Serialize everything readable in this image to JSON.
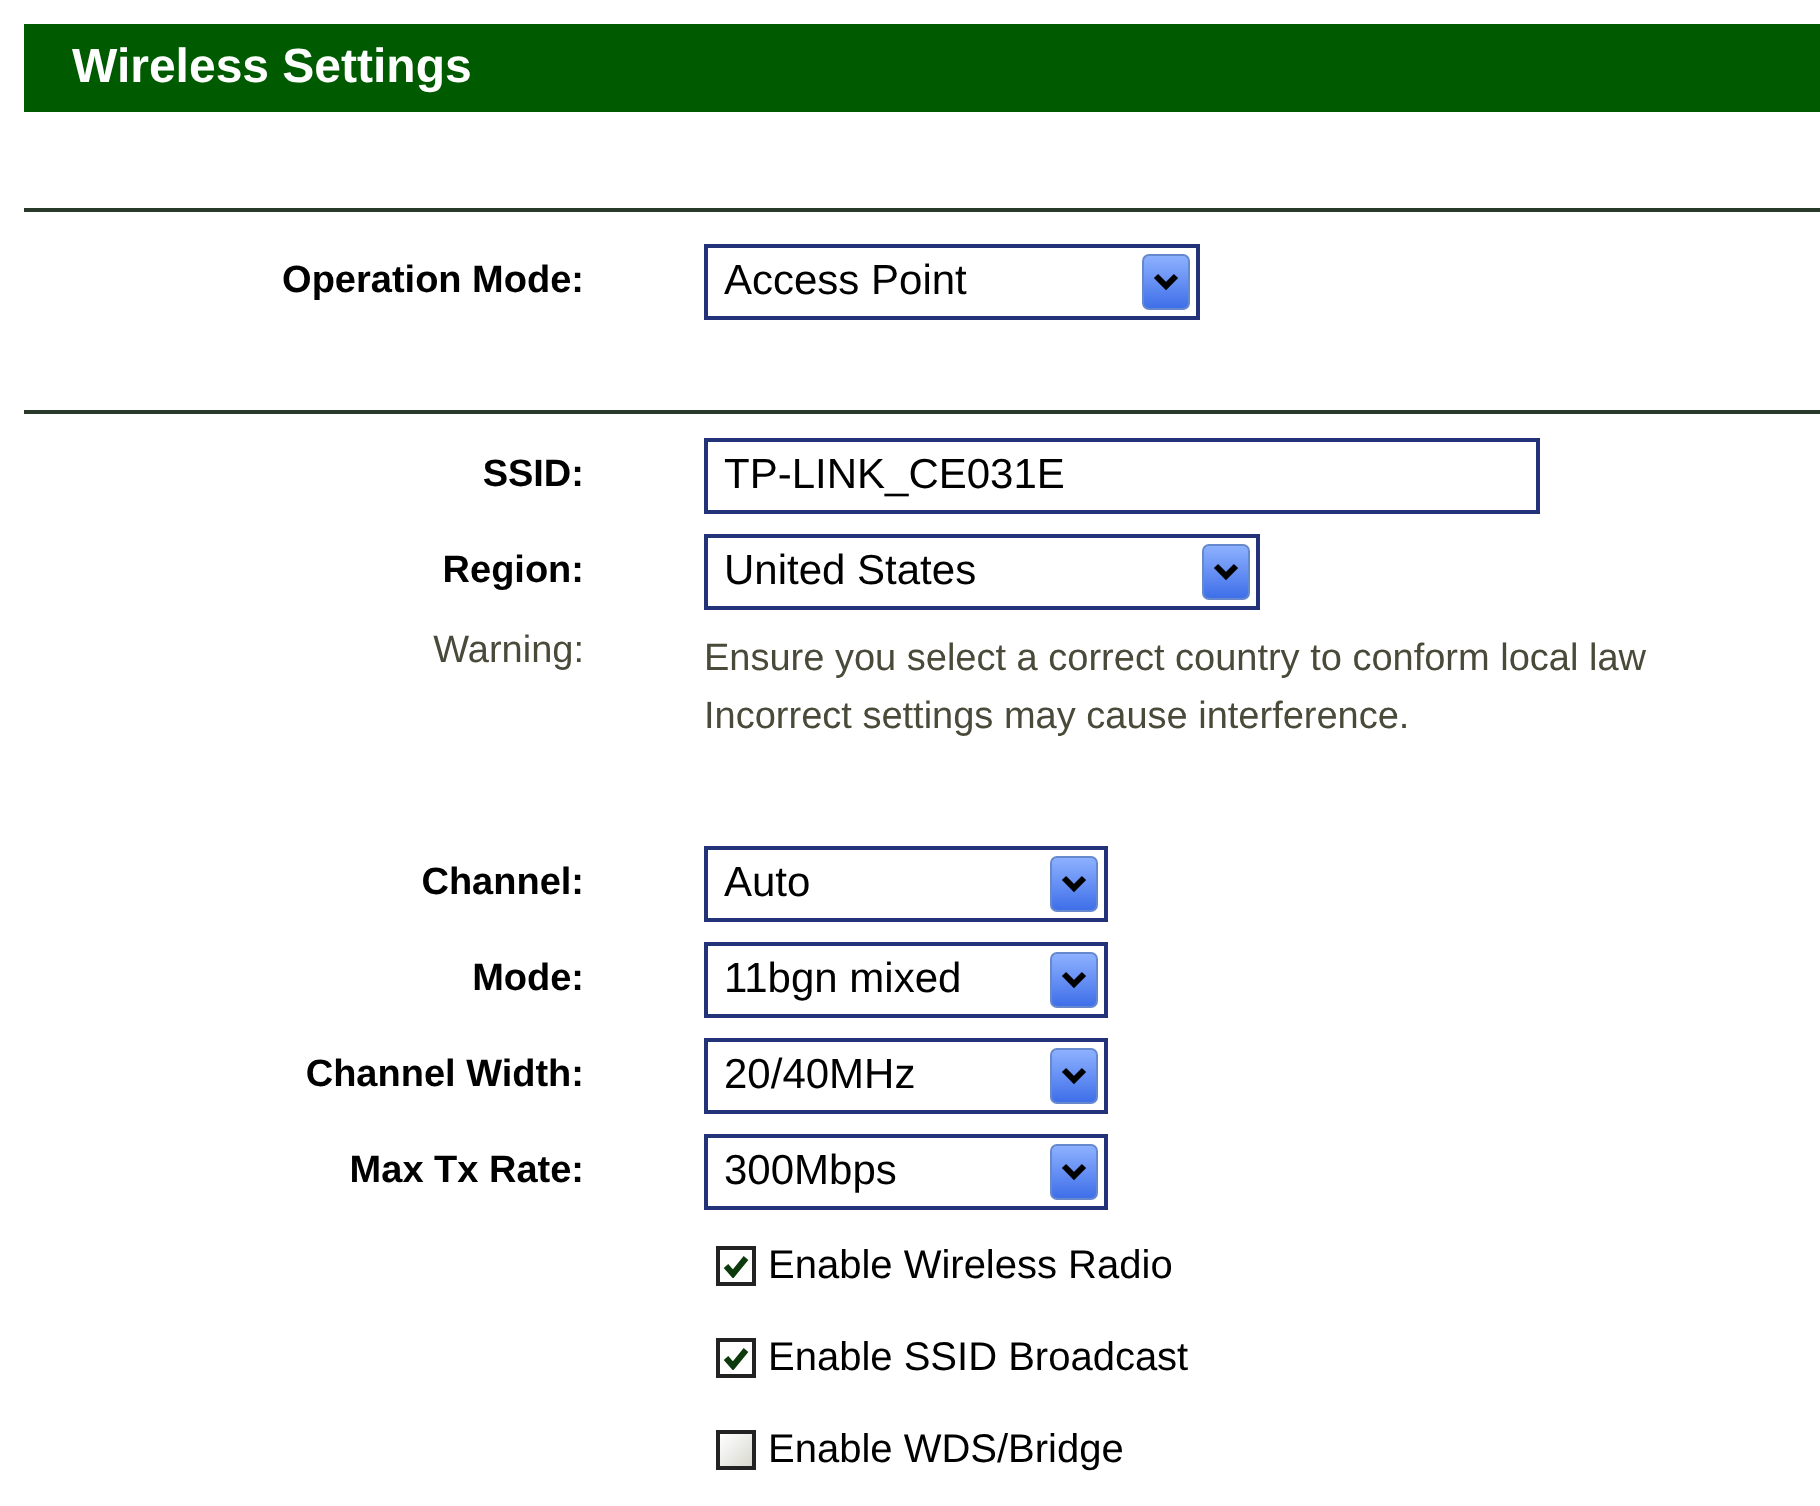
{
  "header": {
    "title": "Wireless Settings"
  },
  "sections": [
    {
      "rows": [
        {
          "kind": "select",
          "label": "Operation Mode:",
          "value": "Access Point"
        }
      ]
    },
    {
      "rows": [
        {
          "kind": "text",
          "label": "SSID:",
          "value": "TP-LINK_CE031E"
        },
        {
          "kind": "select",
          "label": "Region:",
          "value": "United States"
        },
        {
          "kind": "warning",
          "label": "Warning:",
          "lines": [
            "Ensure you select a correct country to conform local law",
            "Incorrect settings may cause interference."
          ]
        },
        {
          "kind": "select",
          "label": "Channel:",
          "value": "Auto"
        },
        {
          "kind": "select",
          "label": "Mode:",
          "value": "11bgn mixed"
        },
        {
          "kind": "select",
          "label": "Channel Width:",
          "value": "20/40MHz"
        },
        {
          "kind": "select",
          "label": "Max Tx Rate:",
          "value": "300Mbps"
        },
        {
          "kind": "checkbox",
          "label": "Enable Wireless Radio",
          "checked": true
        },
        {
          "kind": "checkbox",
          "label": "Enable SSID Broadcast",
          "checked": true
        },
        {
          "kind": "checkbox",
          "label": "Enable WDS/Bridge",
          "checked": false
        }
      ]
    }
  ]
}
